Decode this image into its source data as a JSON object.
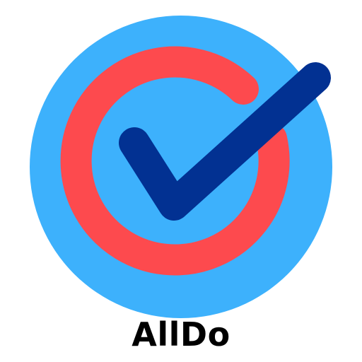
{
  "app": {
    "name": "AllDo"
  },
  "logo": {
    "icon": "check-circle-logo",
    "colors": {
      "outer_circle": "#3db1fc",
      "ring": "#fd4a4e",
      "checkmark": "#023192",
      "text": "#000000",
      "background": "#ffffff"
    }
  }
}
